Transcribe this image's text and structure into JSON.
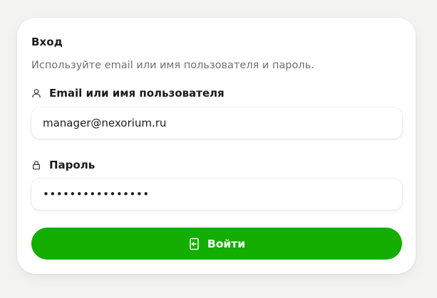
{
  "form": {
    "title": "Вход",
    "subtitle": "Используйте email или имя пользователя и пароль.",
    "login": {
      "label": "Email или имя пользователя",
      "icon": "user-icon",
      "value": "manager@nexorium.ru"
    },
    "password": {
      "label": "Пароль",
      "icon": "lock-icon",
      "value": "••••••••••••••••"
    },
    "submit": {
      "label": "Войти",
      "icon": "login-icon"
    }
  },
  "colors": {
    "page_background": "#f3f4f1",
    "card_background": "#ffffff",
    "primary_button": "#14ae00",
    "text_primary": "#1b1b1b",
    "text_secondary": "#707070"
  }
}
